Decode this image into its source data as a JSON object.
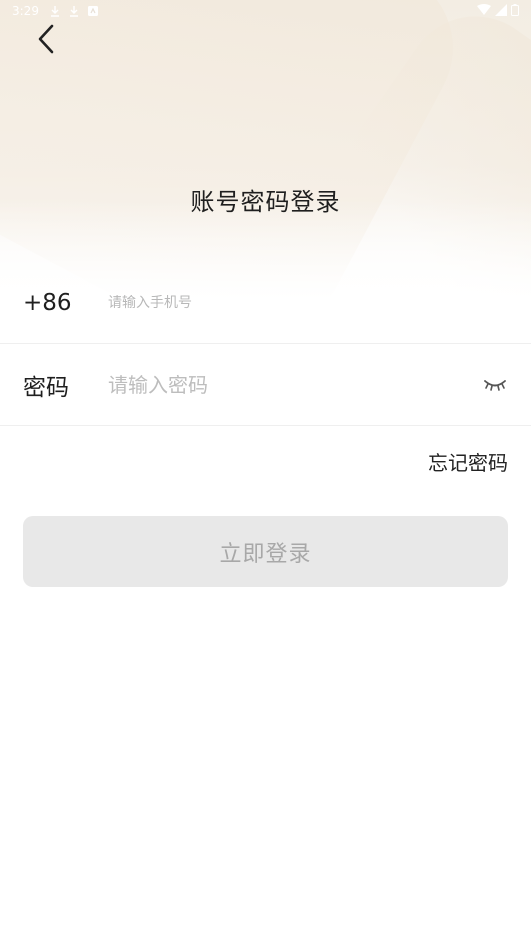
{
  "status_bar": {
    "time": "3:29",
    "left_icons": [
      "download-icon",
      "download-icon",
      "notification-icon"
    ],
    "right_icons": [
      "wifi-icon",
      "signal-icon",
      "battery-icon"
    ]
  },
  "header": {
    "title": "账号密码登录"
  },
  "phone": {
    "country_code": "+86",
    "placeholder": "请输入手机号"
  },
  "password": {
    "label": "密码",
    "placeholder": "请输入密码"
  },
  "forgot_password": "忘记密码",
  "login_button": "立即登录",
  "colors": {
    "hero_bg": "#f3ede3",
    "button_bg": "#e8e8e8",
    "button_text": "#a8a8a8",
    "divider": "#efefef"
  }
}
